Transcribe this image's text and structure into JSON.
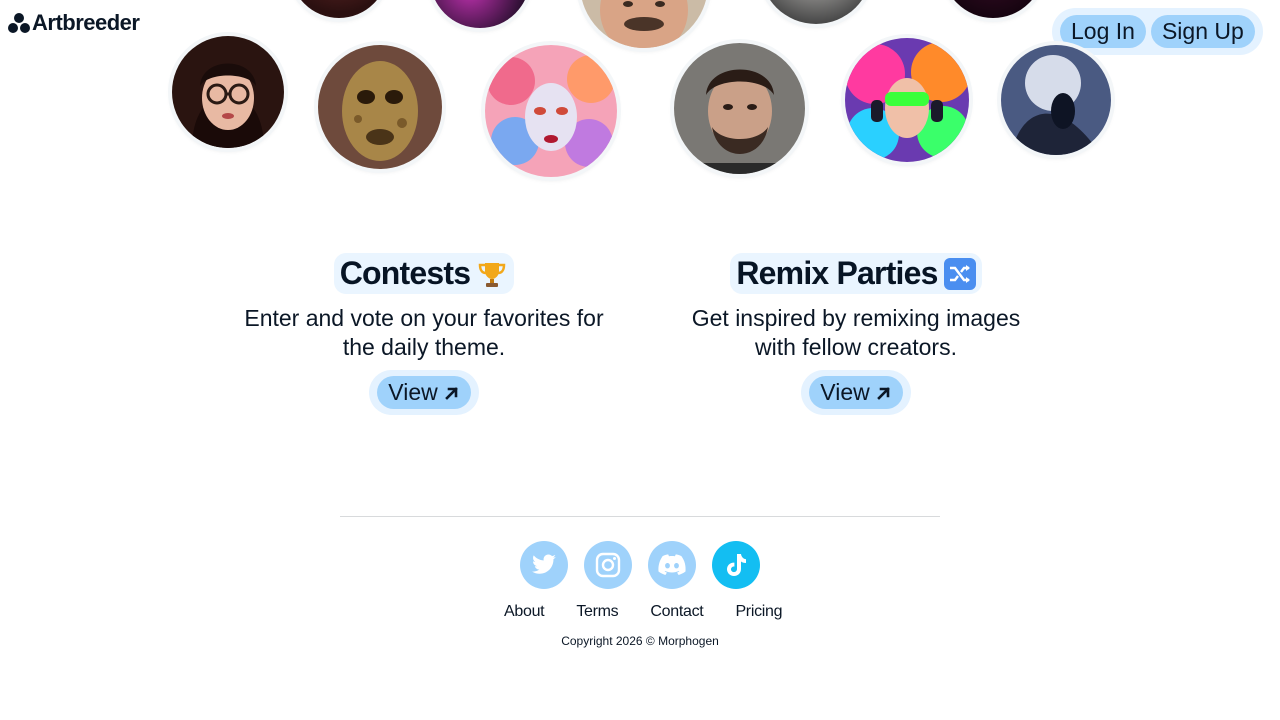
{
  "brand": {
    "name": "Artbreeder"
  },
  "auth": {
    "login_label": "Log In",
    "signup_label": "Sign Up"
  },
  "avatars": [
    {
      "name": "avatar-top-1",
      "desc": "cropped portrait"
    },
    {
      "name": "avatar-top-2",
      "desc": "cropped portrait"
    },
    {
      "name": "avatar-top-3",
      "desc": "mustached man"
    },
    {
      "name": "avatar-top-4",
      "desc": "cropped portrait"
    },
    {
      "name": "avatar-top-5",
      "desc": "cropped portrait"
    },
    {
      "name": "avatar-woman-glasses"
    },
    {
      "name": "avatar-creature-mask"
    },
    {
      "name": "avatar-colorful-woman"
    },
    {
      "name": "avatar-bearded-man"
    },
    {
      "name": "avatar-neon-headphones"
    },
    {
      "name": "avatar-moon-figure"
    }
  ],
  "features": [
    {
      "title": "Contests",
      "emoji": "trophy",
      "description_line1": "Enter and vote on your favorites for",
      "description_line2": "the daily theme.",
      "button_label": "View"
    },
    {
      "title": "Remix Parties",
      "emoji": "shuffle",
      "description_line1": "Get inspired by remixing images",
      "description_line2": "with fellow creators.",
      "button_label": "View"
    }
  ],
  "footer": {
    "socials": [
      "twitter-icon",
      "instagram-icon",
      "discord-icon",
      "tiktok-icon"
    ],
    "links": [
      "About",
      "Terms",
      "Contact",
      "Pricing"
    ],
    "copyright": "Copyright 2026 © Morphogen"
  },
  "colors": {
    "accent": "#9fd2fb",
    "accent_light": "#e4f2ff",
    "tiktok": "#13bef2",
    "text": "#0b1726"
  }
}
